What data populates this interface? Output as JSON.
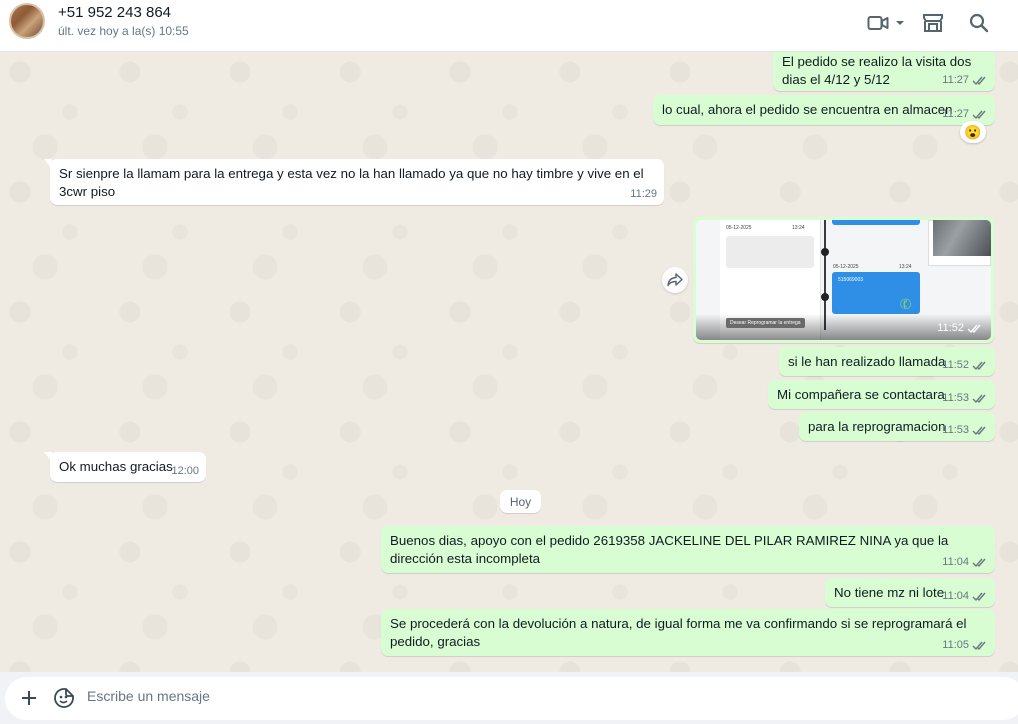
{
  "header": {
    "contact_name": "+51 952 243 864",
    "last_seen": "últ. vez hoy a la(s) 10:55",
    "icons": [
      "video-call-icon",
      "chevron-down-icon",
      "catalog-icon",
      "search-icon"
    ]
  },
  "messages": [
    {
      "direction": "out",
      "text": "El pedido se realizo la visita dos dias el 4/12 y 5/12",
      "time": "11:27",
      "status": "read"
    },
    {
      "direction": "out",
      "text": "lo cual, ahora el pedido se encuentra en almacen",
      "time": "11:27",
      "status": "read",
      "reaction": "😮"
    },
    {
      "direction": "in",
      "text": "Sr sienpre la llamam para la entrega y esta vez no la han llamado ya que no hay timbre y vive en el 3cwr piso",
      "time": "11:29"
    },
    {
      "direction": "out",
      "type": "image",
      "time": "11:52",
      "status": "read",
      "image_texts": {
        "date1": "05-12-2025",
        "time1": "13:24",
        "date2": "05-12-2025",
        "time2": "13:24",
        "blue_card": "515069003",
        "button": "Desear Reprogramar la entrega"
      }
    },
    {
      "direction": "out",
      "text": "si le han realizado llamada",
      "time": "11:52",
      "status": "read"
    },
    {
      "direction": "out",
      "text": "Mi compañera se contactara",
      "time": "11:53",
      "status": "read"
    },
    {
      "direction": "out",
      "text": "para la reprogramacion",
      "time": "11:53",
      "status": "read"
    },
    {
      "direction": "in",
      "text": "Ok muchas gracias",
      "time": "12:00"
    },
    {
      "direction": "out",
      "text": "Buenos dias, apoyo con el pedido 2619358 JACKELINE DEL PILAR RAMIREZ NINA ya que la dirección esta incompleta",
      "time": "11:04",
      "status": "read"
    },
    {
      "direction": "out",
      "text": "No tiene mz ni lote",
      "time": "11:04",
      "status": "read"
    },
    {
      "direction": "out",
      "text": "Se procederá con la devolución a natura, de igual forma me va confirmando si se reprogramará el pedido, gracias",
      "time": "11:05",
      "status": "read"
    }
  ],
  "day_separator": "Hoy",
  "composer": {
    "placeholder": "Escribe un mensaje",
    "icons": [
      "plus-icon",
      "sticker-icon"
    ]
  },
  "colors": {
    "outgoing_bubble": "#d9fdd3",
    "incoming_bubble": "#ffffff",
    "chat_background": "#efeae2",
    "read_ticks": "#53bdeb"
  }
}
